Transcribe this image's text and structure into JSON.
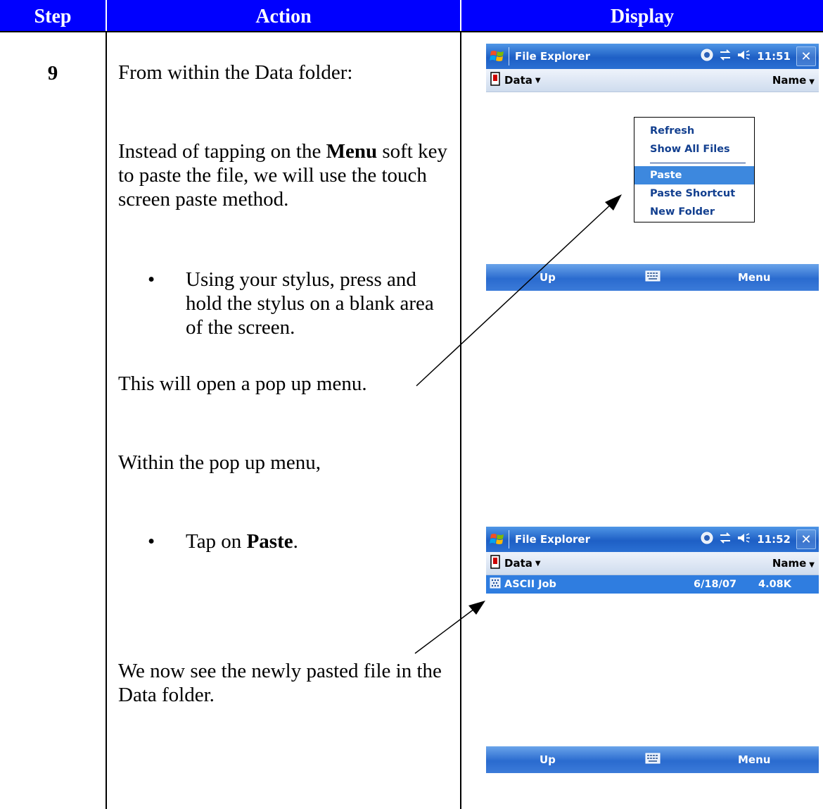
{
  "headers": {
    "step": "Step",
    "action": "Action",
    "display": "Display"
  },
  "step_number": "9",
  "action": {
    "line1": "From within the Data folder:",
    "para2_a": "Instead of tapping on the ",
    "para2_menu": "Menu",
    "para2_b": " soft key to paste the file, we will use the touch screen paste method.",
    "bullet1": "Using your stylus, press and hold the stylus on a blank area of the screen.",
    "line_popup": "This will open a pop up menu.",
    "line_within": "Within the pop up menu,",
    "bullet2_a": "Tap on ",
    "bullet2_paste": "Paste",
    "bullet2_b": ".",
    "line_result": "We now see the newly pasted file in the Data folder."
  },
  "screen1": {
    "title": "File Explorer",
    "time": "11:51",
    "close": "✕",
    "folder": "Data",
    "sort": "Name",
    "popup_items": [
      "Refresh",
      "Show All Files",
      "Paste",
      "Paste Shortcut",
      "New Folder"
    ],
    "selected_item": "Paste",
    "soft_left": "Up",
    "soft_right": "Menu"
  },
  "screen2": {
    "title": "File Explorer",
    "time": "11:52",
    "close": "✕",
    "folder": "Data",
    "sort": "Name",
    "file_name": "ASCII Job",
    "file_date": "6/18/07",
    "file_size": "4.08K",
    "soft_left": "Up",
    "soft_right": "Menu"
  },
  "colors": {
    "header_bg": "#0000ff",
    "title_bar": "#1e5fc5",
    "selection": "#2f7de0"
  },
  "icons": [
    "windows-flag-icon",
    "connectivity-icon",
    "sync-icon",
    "speaker-icon",
    "close-icon",
    "storage-card-icon",
    "keyboard-icon",
    "file-icon",
    "arrow-icon"
  ]
}
